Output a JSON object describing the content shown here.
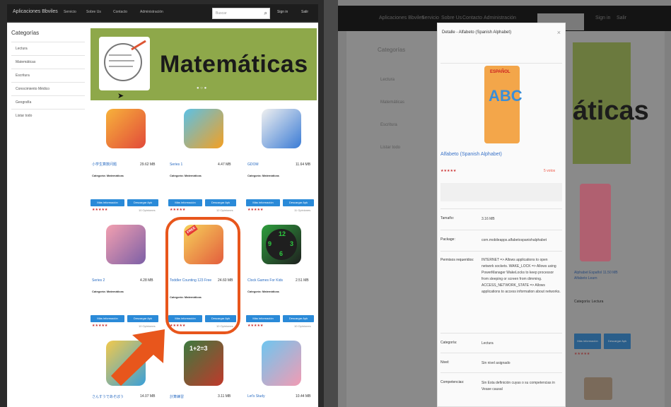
{
  "left": {
    "nav": {
      "brand": "Aplicaciones Bbviles",
      "links": [
        "Servicio",
        "Sobre Us",
        "Contacto",
        "Administración"
      ],
      "search_placeholder": "Buscar",
      "user": "Sign in",
      "user2": "Salir"
    },
    "sidebar": {
      "title": "Categorías",
      "items": [
        "Lectura",
        "Matemáticas",
        "Escritura",
        "Conocimiento Médico",
        "Geografía",
        "Listar todo"
      ]
    },
    "banner": {
      "text": "Matemáticas",
      "dots": "● ○ ●"
    },
    "apps": [
      {
        "title": "小学生算数问题",
        "size": "29.62 MB",
        "cat": "Categoría: Matemáticas",
        "btn1": "Más información",
        "btn2": "Descargar Apk",
        "stars": "★★★★★",
        "votes": "10 Opiniones"
      },
      {
        "title": "Series 1",
        "size": "4.47 MB",
        "cat": "Categoría: Matemáticas",
        "btn1": "Más información",
        "btn2": "Descargar Apk",
        "stars": "★★★★★",
        "votes": "12 Opiniones"
      },
      {
        "title": "GDOM",
        "size": "11.64 MB",
        "cat": "Categoría: Matemáticas",
        "btn1": "Más información",
        "btn2": "Descargar Apk",
        "stars": "★★★★★",
        "votes": "11 Opiniones"
      },
      {
        "title": "Series 2",
        "size": "4.28 MB",
        "cat": "Categoría: Matemáticas",
        "btn1": "Más información",
        "btn2": "Descargar Apk",
        "stars": "★★★★★",
        "votes": "10 Opiniones"
      },
      {
        "title": "Toddler Counting 123 Free",
        "size": "24.60 MB",
        "cat": "Categoría: Matemáticas",
        "btn1": "Más información",
        "btn2": "Descargar Apk",
        "stars": "★★★★★",
        "votes": "10 Opiniones"
      },
      {
        "title": "Clock Games For Kids",
        "size": "2.51 MB",
        "cat": "Categoría: Matemáticas",
        "btn1": "Más información",
        "btn2": "Descargar Apk",
        "stars": "★★★★★",
        "votes": "10 Opiniones"
      },
      {
        "title": "さんすうであそぼう",
        "size": "14.07 MB",
        "cat": "",
        "btn1": "",
        "btn2": "",
        "stars": "",
        "votes": ""
      },
      {
        "title": "計算練習",
        "size": "3.11 MB",
        "cat": "",
        "btn1": "",
        "btn2": "",
        "stars": "",
        "votes": ""
      },
      {
        "title": "Let's Study",
        "size": "10.44 MB",
        "cat": "",
        "btn1": "",
        "btn2": "",
        "stars": "",
        "votes": ""
      }
    ],
    "icons": [
      "hero-boy",
      "bars-chart",
      "rocket-shapes",
      "family-photo",
      "counting-123",
      "green-clock",
      "kids-123",
      "chalkboard-math",
      "girl-math"
    ],
    "clock_icon_text": {
      "top": "12",
      "left": "9",
      "right": "3",
      "bottom": "6"
    },
    "chalk_icon_text": "1+2=3",
    "badge_free": "FREE"
  },
  "right": {
    "nav": {
      "brand": "Aplicaciones Bbviles",
      "links": [
        "Servicio",
        "Sobre Us",
        "Contacto",
        "Administración"
      ],
      "user": "Sign in",
      "user2": "Salir"
    },
    "sidebar": {
      "title": "Categorías",
      "items": [
        "Lectura",
        "Matemáticas",
        "Escritura",
        "Listar todo"
      ]
    },
    "banner_text": "áticas",
    "bg_card": {
      "title": "Alphabet Español",
      "size": "11.50 MB",
      "extra": "Alfabeto Learn",
      "cat": "Categoría: Lectura",
      "btn1": "Más información",
      "btn2": "Descargar Apk",
      "stars": "★★★★★"
    },
    "modal": {
      "title": "Detalle - Alfabeto (Spanish Alphabet)",
      "close": "×",
      "icon_label": "ESPAÑOL",
      "icon_letters": "ABC",
      "app_name": "Alfabeto (Spanish Alphabet)",
      "stars": "★★★★★",
      "votes": "5 votos",
      "rows": [
        {
          "label": "Tamaño:",
          "value": "3.16 MB"
        },
        {
          "label": "Package:",
          "value": "com.mobileapps.alfabetospanishalphabet"
        },
        {
          "label": "Permisos requeridos:",
          "value": "INTERNET => Allows applications to open network sockets. WAKE_LOCK => Allows using PowerManager WakeLocks to keep processor from sleeping or screen from dimming. ACCESS_NETWORK_STATE => Allows applications to access information about networks."
        },
        {
          "label": "Categoría:",
          "value": "Lectura"
        },
        {
          "label": "Nivel:",
          "value": "Sin nivel asignado"
        },
        {
          "label": "Competencias:",
          "value": "Sin Esta definición cuyas o su competencias in Vease causal"
        }
      ]
    }
  },
  "colors": {
    "accent": "#2a8ad8",
    "highlight": "#e8561c",
    "banner_green": "#8ea84a",
    "link_blue": "#2a6cc2"
  }
}
